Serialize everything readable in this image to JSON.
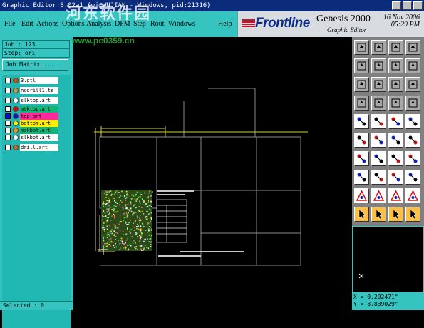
{
  "window": {
    "title": "Graphic Editor 8.02a1 (wj@WUJIAN - Windows, pid:21316)"
  },
  "watermark": {
    "text1": "河东软件园",
    "text2": "www.pc0359.cn"
  },
  "menu": [
    "File",
    "Edit",
    "Actions",
    "Options",
    "Analysis",
    "DFM",
    "Step",
    "Rout",
    "Windows",
    "Help"
  ],
  "banner": {
    "logo": "Frontline",
    "product": "Genesis 2000",
    "subtitle": "Graphic Editor",
    "date": "16 Nov 2006",
    "time": "05:29 PM"
  },
  "left": {
    "job": "Job : 123",
    "step": "Step: ori",
    "job_matrix": "Job Matrix ...",
    "layers": [
      {
        "name": "3.gtl",
        "dot": "#b85a10",
        "bg": "#ffffff"
      },
      {
        "name": "ncdrill1.te",
        "dot": "#b8a040",
        "bg": "#ffffff"
      },
      {
        "name": "slktop.art",
        "dot": "#ffffff",
        "bg": "#ffffff"
      },
      {
        "name": "msktop.art",
        "dot": "#d01010",
        "bg": "#12b67a"
      },
      {
        "name": "top.art",
        "dot": "#1010c0",
        "bg": "#ff2a9e"
      },
      {
        "name": "bottom.art",
        "dot": "#ffee00",
        "bg": "#ffee00"
      },
      {
        "name": "mskbot.art",
        "dot": "#e0a020",
        "bg": "#12b67a"
      },
      {
        "name": "slkbot.art",
        "dot": "#ffffff",
        "bg": "#ffffff"
      },
      {
        "name": "drill.art",
        "dot": "#b07020",
        "bg": "#ffffff"
      }
    ],
    "selected": "Selected : 0"
  },
  "tools": [
    "move-up-icon",
    "move-down-icon",
    "home-icon",
    "zoom-window-icon",
    "pan-icon",
    "redraw-icon",
    "window-icon",
    "grid-icon",
    "fit-icon",
    "zoom-in-icon",
    "scale-icon",
    "close-icon",
    "network-icon",
    "layers-icon",
    "undo-icon",
    "highlight-icon",
    "draw-line-icon",
    "add-pad-icon",
    "ruler-icon",
    "reshape-icon",
    "connect-icon",
    "delete-icon",
    "node-icon",
    "edit-icon",
    "line-icon",
    "surface-icon",
    "rotate-icon",
    "copy-icon",
    "measure-icon",
    "snap-icon",
    "text-icon",
    "flip-icon",
    "triangle-icon",
    "delta-icon",
    "change-icon",
    "net-icon",
    "select-arrow-icon",
    "select-arrow2-icon",
    "select-arrow3-icon",
    "select-arrow4-icon"
  ],
  "coords": {
    "x": "X = 0.202471\"",
    "y": "Y = 8.839029\""
  }
}
